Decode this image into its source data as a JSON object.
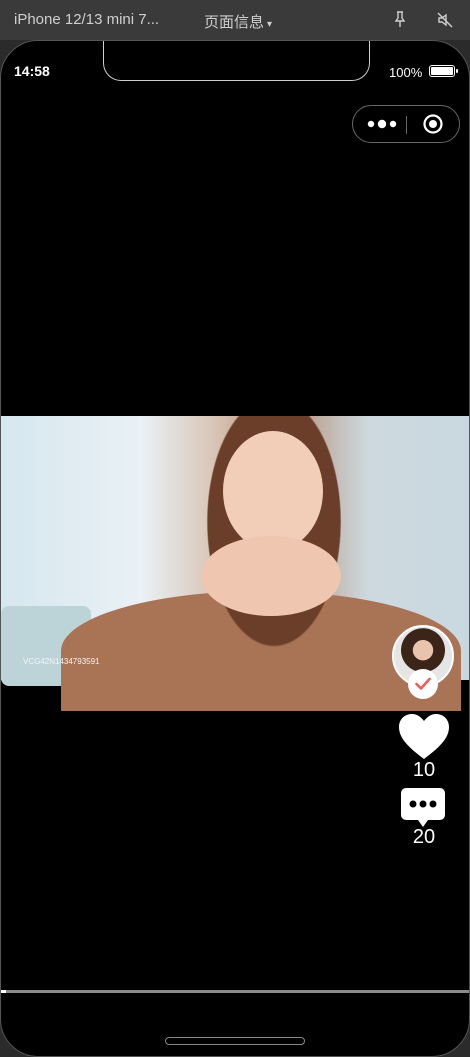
{
  "devtools": {
    "device_label": "iPhone 12/13 mini 7...",
    "page_info_label": "页面信息"
  },
  "status_bar": {
    "time": "14:58",
    "battery_percent": "100%",
    "battery_level": 1.0
  },
  "video": {
    "watermark": "VCG42N1434793591"
  },
  "actions": {
    "like_count": "10",
    "comment_count": "20"
  },
  "playback": {
    "progress": 0.01
  },
  "colors": {
    "background": "#000000",
    "follow_check": "#f05a5a",
    "icons": "#ffffff"
  },
  "icons": {
    "menu": "more-dots-icon",
    "close": "target-circle-icon",
    "like": "heart-icon",
    "comment": "comment-bubble-icon",
    "follow": "check-icon"
  }
}
